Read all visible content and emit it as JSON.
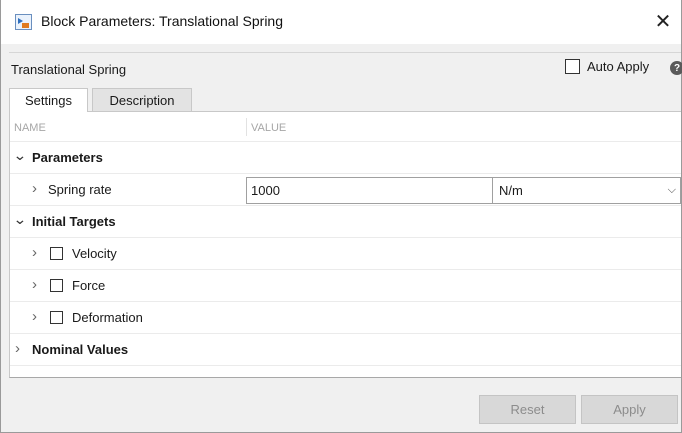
{
  "window": {
    "title": "Block Parameters: Translational Spring",
    "close_glyph": "✕"
  },
  "block": {
    "name": "Translational Spring",
    "auto_apply_label": "Auto Apply",
    "auto_apply_checked": false,
    "help_glyph": "?"
  },
  "tabs": [
    {
      "label": "Settings",
      "active": true
    },
    {
      "label": "Description",
      "active": false
    }
  ],
  "table": {
    "col_name": "NAME",
    "col_value": "VALUE",
    "parameters": {
      "label": "Parameters",
      "expanded": true,
      "spring_rate": {
        "label": "Spring rate",
        "value": "1000",
        "unit": "N/m"
      }
    },
    "initial_targets": {
      "label": "Initial Targets",
      "expanded": true,
      "items": [
        {
          "label": "Velocity",
          "checked": false
        },
        {
          "label": "Force",
          "checked": false
        },
        {
          "label": "Deformation",
          "checked": false
        }
      ]
    },
    "nominal_values": {
      "label": "Nominal Values",
      "expanded": false
    }
  },
  "footer": {
    "reset_label": "Reset",
    "apply_label": "Apply"
  },
  "glyphs": {
    "expanded": "⌄",
    "collapsed": "›",
    "dropdown": "⌵"
  },
  "colors": {
    "app_icon_blue": "#2f6fbe",
    "app_icon_orange": "#e07a1f"
  }
}
